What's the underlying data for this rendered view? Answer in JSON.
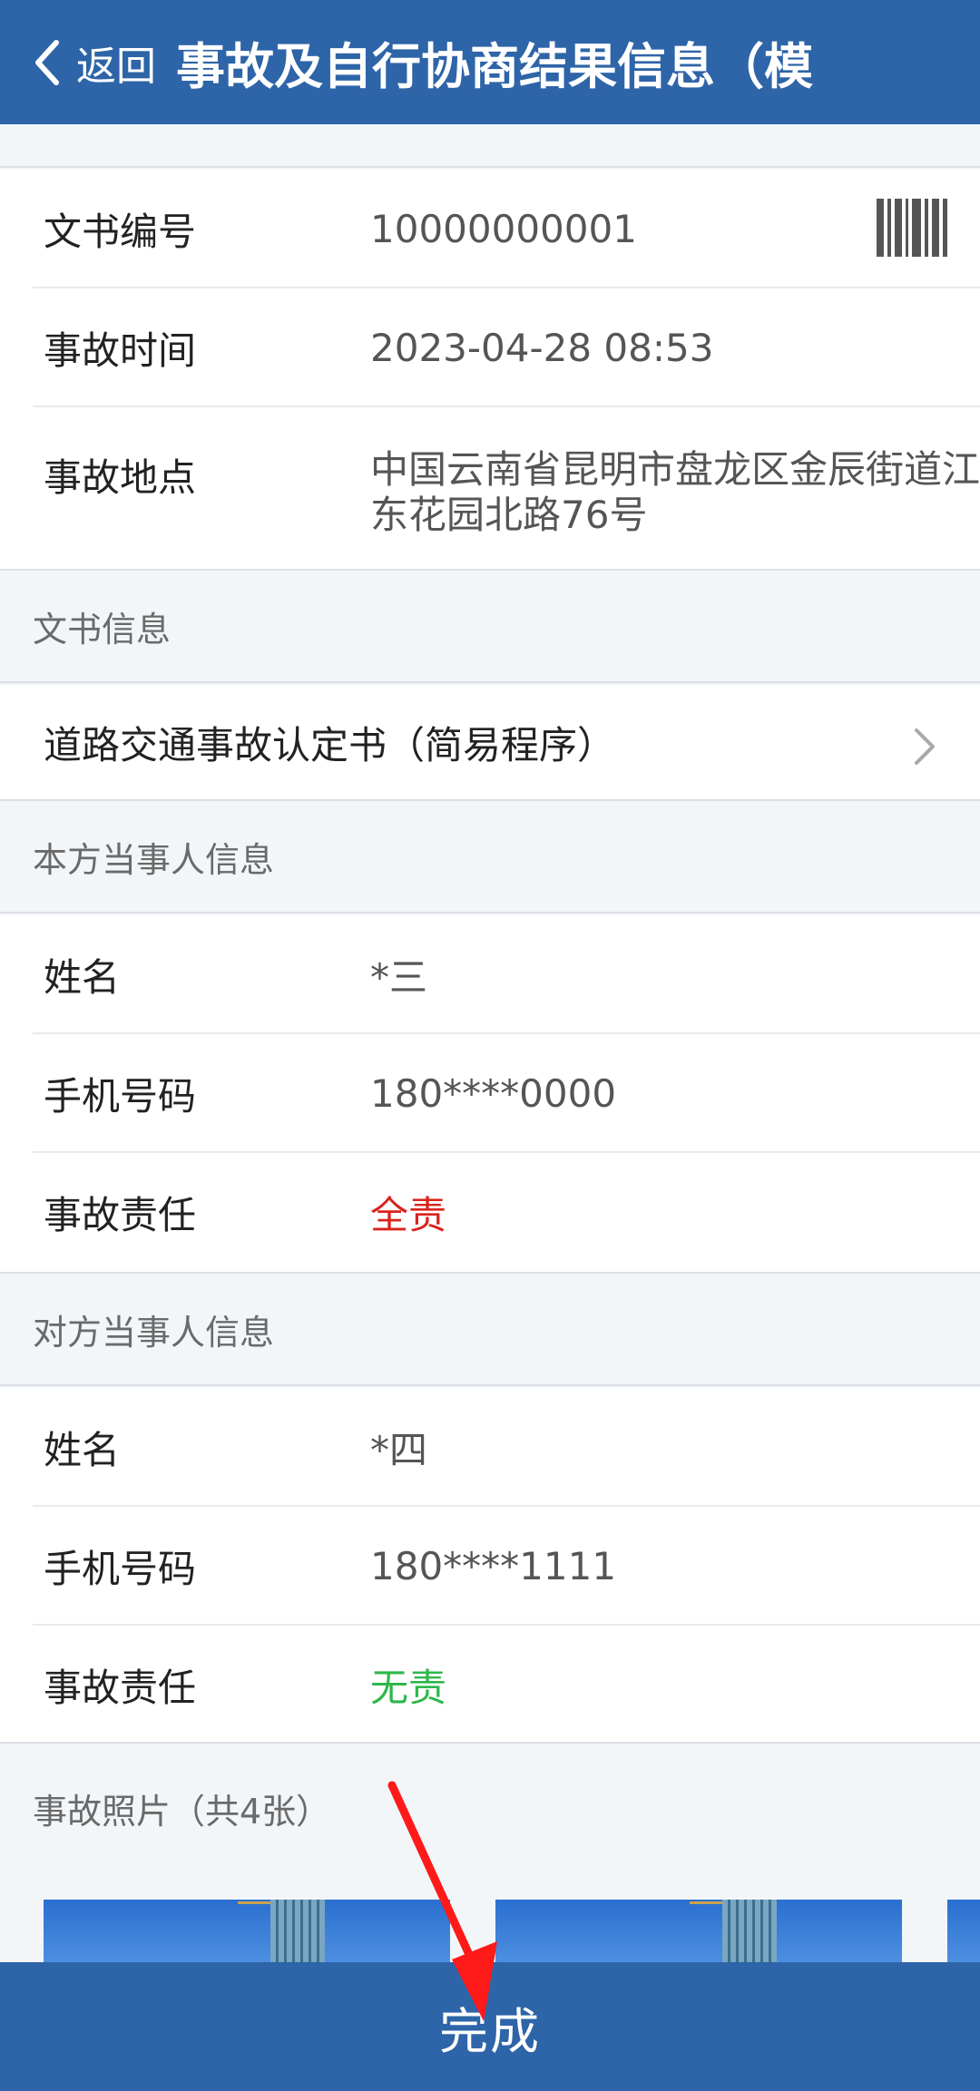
{
  "header": {
    "back_label": "返回",
    "title": "事故及自行协商结果信息（模"
  },
  "accident": {
    "doc_no_label": "文书编号",
    "doc_no": "10000000001",
    "time_label": "事故时间",
    "time": "2023-04-28 08:53",
    "place_label": "事故地点",
    "place_line1": "中国云南省昆明市盘龙区金辰街道江",
    "place_line2": "东花园北路76号"
  },
  "doc_info": {
    "section_title": "文书信息",
    "item": "道路交通事故认定书（简易程序）"
  },
  "self_party": {
    "section_title": "本方当事人信息",
    "name_label": "姓名",
    "name": "*三",
    "phone_label": "手机号码",
    "phone": "180****0000",
    "liability_label": "事故责任",
    "liability": "全责",
    "liability_color": "#d9231d"
  },
  "other_party": {
    "section_title": "对方当事人信息",
    "name_label": "姓名",
    "name": "*四",
    "phone_label": "手机号码",
    "phone": "180****1111",
    "liability_label": "事故责任",
    "liability": "无责",
    "liability_color": "#2db84a"
  },
  "photos": {
    "section_title": "事故照片（共4张）",
    "items": [
      "photo-1",
      "photo-2",
      "photo-3"
    ]
  },
  "footer": {
    "done_label": "完成"
  },
  "colors": {
    "brand": "#2e64a8",
    "annotation_arrow": "#ff1a1a"
  }
}
